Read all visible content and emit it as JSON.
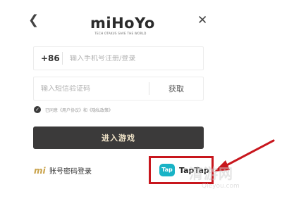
{
  "header": {
    "back_icon": "chevron-left-icon",
    "close_icon": "close-icon",
    "logo_text": "miHoYo",
    "logo_tagline": "TECH OTAKUS SAVE THE WORLD"
  },
  "phone_field": {
    "country_code": "+86",
    "placeholder": "输入手机号注册/登录",
    "value": ""
  },
  "code_field": {
    "placeholder": "输入短信验证码",
    "value": "",
    "get_code_label": "获取"
  },
  "agreement": {
    "checked": true,
    "text": "已同意《用户协议》和《隐私政策》"
  },
  "enter_button_label": "进入游戏",
  "password_login": {
    "icon": "mi-logo-icon",
    "label": "账号密码登录"
  },
  "taptap": {
    "icon_text": "Tap",
    "label": "TapTap",
    "highlight_color": "#c8161d"
  },
  "watermark": {
    "logo": "清游网",
    "url": "Qleyou.com"
  },
  "colors": {
    "button_bg": "#3b3a3a",
    "button_text": "#f0e3c8",
    "taptap_brand": "#19b3c6",
    "annotation": "#c8161d"
  }
}
